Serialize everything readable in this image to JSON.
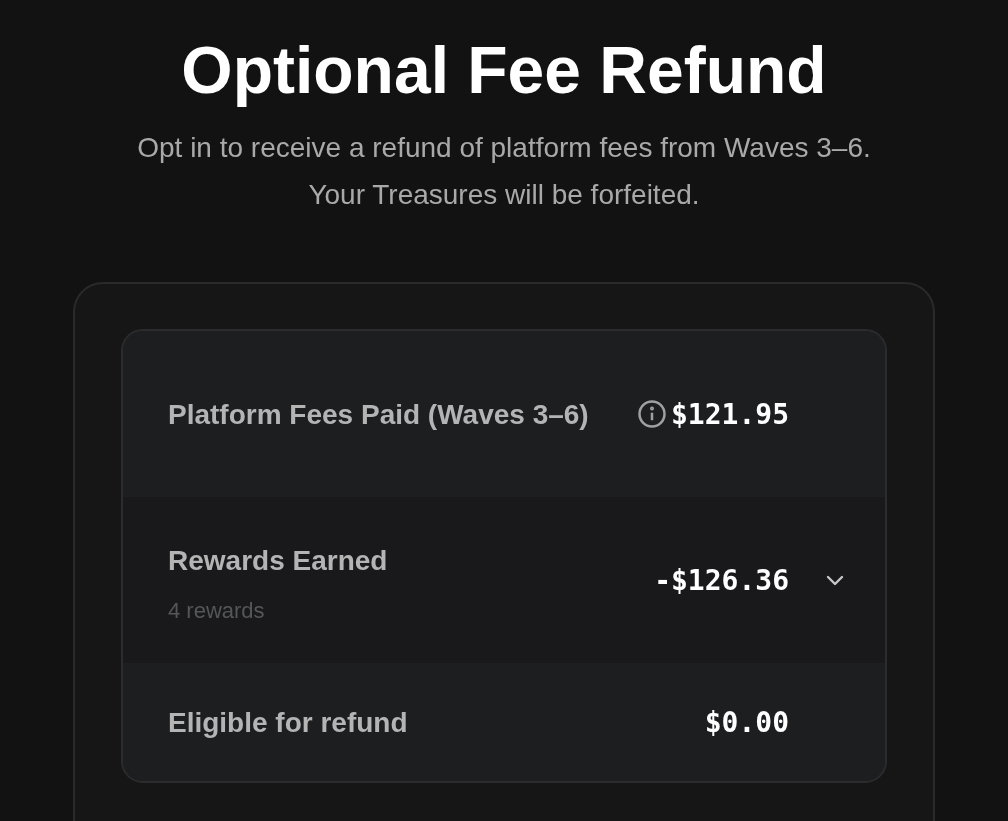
{
  "title": "Optional Fee Refund",
  "subtitle": [
    "Opt in to receive a refund of platform fees from Waves 3–6.",
    "Your Treasures will be forfeited."
  ],
  "rows": [
    {
      "kind": "info",
      "label": "Platform Fees Paid (Waves 3–6)",
      "value": "$121.95"
    },
    {
      "kind": "expandable",
      "label": "Rewards Earned",
      "sublabel": "4 rewards",
      "value": "-$126.36",
      "expanded": false
    },
    {
      "kind": "plain",
      "label": "Eligible for refund",
      "value": "$0.00"
    }
  ]
}
